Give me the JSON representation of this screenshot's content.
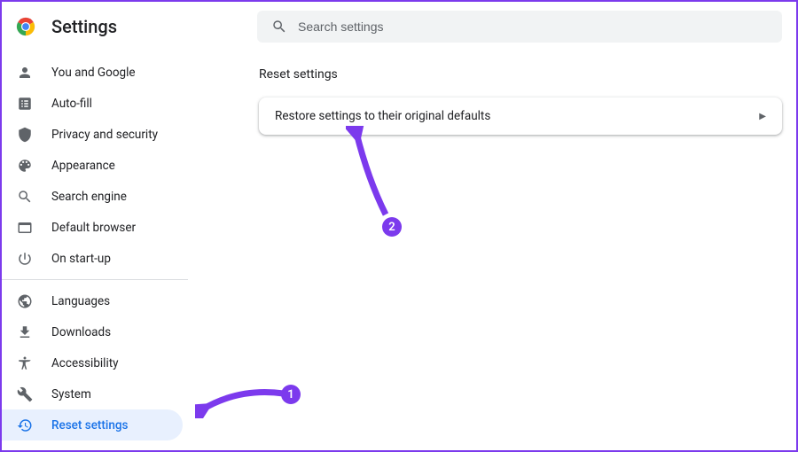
{
  "header": {
    "title": "Settings",
    "search_placeholder": "Search settings"
  },
  "sidebar": {
    "group1": [
      {
        "icon": "person",
        "label": "You and Google"
      },
      {
        "icon": "autofill",
        "label": "Auto-fill"
      },
      {
        "icon": "shield",
        "label": "Privacy and security"
      },
      {
        "icon": "palette",
        "label": "Appearance"
      },
      {
        "icon": "search",
        "label": "Search engine"
      },
      {
        "icon": "browser",
        "label": "Default browser"
      },
      {
        "icon": "power",
        "label": "On start-up"
      }
    ],
    "group2": [
      {
        "icon": "globe",
        "label": "Languages"
      },
      {
        "icon": "download",
        "label": "Downloads"
      },
      {
        "icon": "accessibility",
        "label": "Accessibility"
      },
      {
        "icon": "wrench",
        "label": "System"
      },
      {
        "icon": "reset",
        "label": "Reset settings",
        "active": true
      }
    ]
  },
  "main": {
    "section_title": "Reset settings",
    "card_text": "Restore settings to their original defaults"
  },
  "annotations": {
    "step1": "1",
    "step2": "2"
  },
  "colors": {
    "accent": "#1a73e8",
    "annotation": "#7c3aed"
  }
}
